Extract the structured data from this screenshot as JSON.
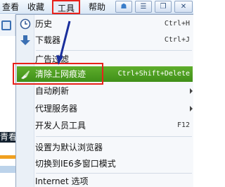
{
  "menubar": {
    "items": [
      {
        "label": "查看"
      },
      {
        "label": "收藏"
      },
      {
        "label": "工具"
      },
      {
        "label": "帮助"
      }
    ],
    "window_controls": [
      "skin-icon",
      "menu-icon",
      "restore-icon",
      "close-icon"
    ]
  },
  "background_page": {
    "text_fragment": "青看"
  },
  "tools_menu": {
    "items": [
      {
        "label": "历史",
        "shortcut": "Ctrl+H",
        "icon": "clock-icon"
      },
      {
        "label": "下载器",
        "shortcut": "Ctrl+J",
        "icon": "download-arrow-icon"
      },
      {
        "label": "广告过滤",
        "shortcut": "",
        "icon": ""
      },
      {
        "label": "清除上网痕迹",
        "shortcut": "Ctrl+Shift+Delete",
        "icon": "broom-icon"
      },
      {
        "label": "自动刷新",
        "shortcut": "",
        "icon": ""
      },
      {
        "label": "代理服务器",
        "shortcut": "",
        "icon": ""
      },
      {
        "label": "开发人员工具",
        "shortcut": "F12",
        "icon": ""
      },
      {
        "label": "设置为默认浏览器",
        "shortcut": "",
        "icon": ""
      },
      {
        "label": "切换到IE6多窗口模式",
        "shortcut": "",
        "icon": ""
      },
      {
        "label": "Internet 选项",
        "shortcut": "",
        "icon": ""
      }
    ]
  },
  "colors": {
    "highlight": "#4a9c20",
    "annotation_red": "#e8221b",
    "annotation_arrow": "#1a2f9c"
  }
}
